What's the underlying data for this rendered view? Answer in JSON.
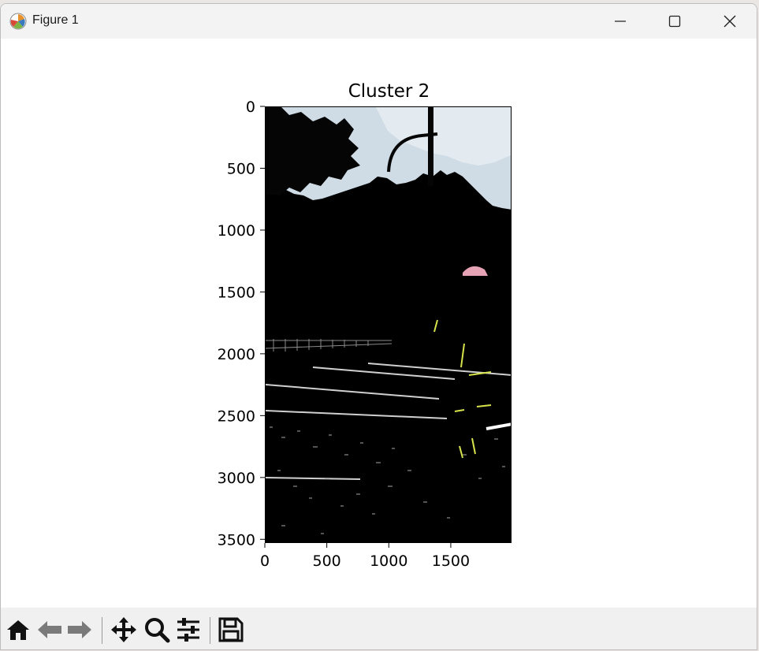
{
  "window": {
    "title": "Figure 1",
    "icons": {
      "app": "matplotlib-icon",
      "minimize": "minimize-icon",
      "maximize": "maximize-icon",
      "close": "close-icon"
    }
  },
  "figure": {
    "title": "Cluster 2",
    "image_description_colors": {
      "sky": "#d4dfe6",
      "background": "#000000",
      "highlight": "#d6e34a",
      "helmet": "#e7a3b6"
    }
  },
  "chart_data": {
    "type": "image",
    "title": "Cluster 2",
    "xlabel": "",
    "ylabel": "",
    "x_ticks": [
      0,
      500,
      1000,
      1500
    ],
    "y_ticks": [
      0,
      500,
      1000,
      1500,
      2000,
      2500,
      3000,
      3500
    ],
    "xlim": [
      0,
      1990
    ],
    "ylim": [
      3530,
      0
    ],
    "grid": false
  },
  "toolbar": {
    "buttons": [
      {
        "name": "home-button",
        "icon": "home-icon"
      },
      {
        "name": "back-button",
        "icon": "back-arrow-icon"
      },
      {
        "name": "forward-button",
        "icon": "forward-arrow-icon"
      },
      {
        "name": "pan-button",
        "icon": "move-icon"
      },
      {
        "name": "zoom-button",
        "icon": "magnifier-icon"
      },
      {
        "name": "configure-subplots-button",
        "icon": "sliders-icon"
      },
      {
        "name": "save-button",
        "icon": "floppy-disk-icon"
      }
    ]
  }
}
